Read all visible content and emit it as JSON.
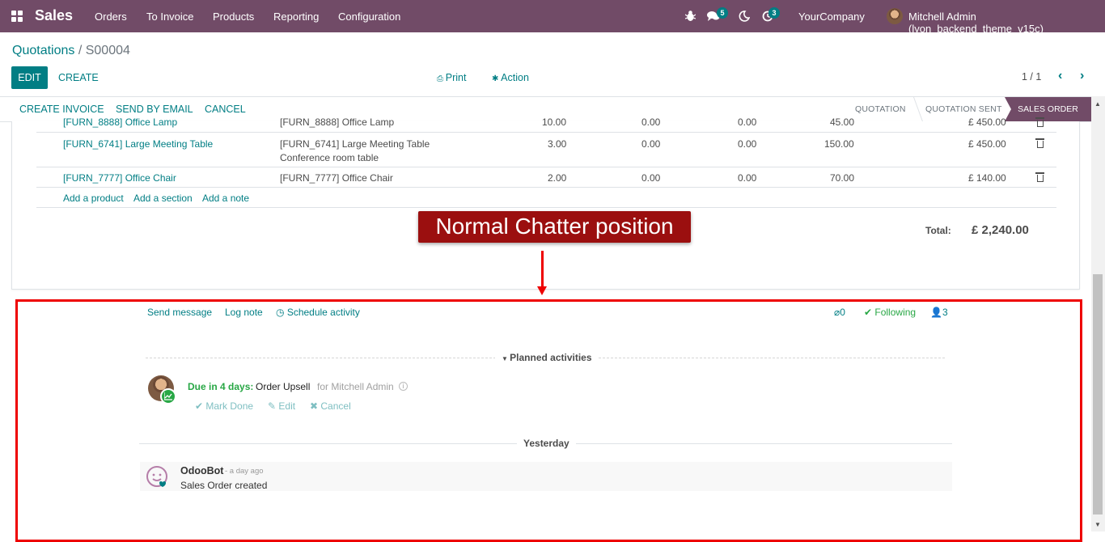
{
  "navbar": {
    "app_name": "Sales",
    "menu": [
      "Orders",
      "To Invoice",
      "Products",
      "Reporting",
      "Configuration"
    ],
    "messages_count": "5",
    "activities_count": "3",
    "company": "YourCompany",
    "user": "Mitchell Admin (lyon_backend_theme_v15c)"
  },
  "breadcrumb": {
    "parent": "Quotations",
    "separator": " / ",
    "current": "S00004"
  },
  "control_panel": {
    "edit": "EDIT",
    "create": "CREATE",
    "print": "Print",
    "action": "Action",
    "pager": "1 / 1"
  },
  "statusbar": {
    "buttons": [
      "CREATE INVOICE",
      "SEND BY EMAIL",
      "CANCEL"
    ],
    "stages": [
      "QUOTATION",
      "QUOTATION SENT",
      "SALES ORDER"
    ],
    "active_stage": "SALES ORDER"
  },
  "order_lines": [
    {
      "product": "[FURN_8888] Office Lamp",
      "description": "[FURN_8888] Office Lamp",
      "description2": "",
      "qty": "10.00",
      "delivered": "0.00",
      "invoiced": "0.00",
      "price": "45.00",
      "subtotal": "£ 450.00"
    },
    {
      "product": "[FURN_6741] Large Meeting Table",
      "description": "[FURN_6741] Large Meeting Table",
      "description2": "Conference room table",
      "qty": "3.00",
      "delivered": "0.00",
      "invoiced": "0.00",
      "price": "150.00",
      "subtotal": "£ 450.00"
    },
    {
      "product": "[FURN_7777] Office Chair",
      "description": "[FURN_7777] Office Chair",
      "description2": "",
      "qty": "2.00",
      "delivered": "0.00",
      "invoiced": "0.00",
      "price": "70.00",
      "subtotal": "£ 140.00"
    }
  ],
  "add_links": [
    "Add a product",
    "Add a section",
    "Add a note"
  ],
  "total": {
    "label": "Total:",
    "value": "£ 2,240.00"
  },
  "annotation": "Normal Chatter position",
  "chatter": {
    "send_message": "Send message",
    "log_note": "Log note",
    "schedule_activity": "Schedule activity",
    "attachments": "0",
    "following": "Following",
    "followers": "3",
    "planned_header": "Planned activities",
    "activity": {
      "due": "Due in 4 days:",
      "summary": "Order Upsell",
      "assigned": "for Mitchell Admin",
      "mark_done": "Mark Done",
      "edit": "Edit",
      "cancel": "Cancel"
    },
    "date_separator": "Yesterday",
    "message": {
      "author": "OdooBot",
      "date": "- a day ago",
      "body": "Sales Order created"
    }
  },
  "colors": {
    "primary": "#714b67",
    "accent": "#017e84",
    "highlight": "#e00000",
    "success": "#28a745"
  }
}
